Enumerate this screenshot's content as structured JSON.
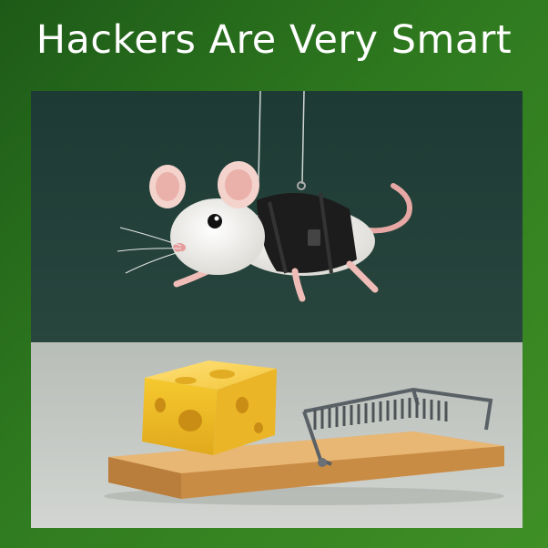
{
  "title": "Hackers Are Very Smart",
  "colors": {
    "frame_green": "#2f7a1f",
    "wall": "#213f38",
    "floor": "#c3c7c2",
    "cheese": "#f2c230",
    "trap_wood": "#d9a35a",
    "mouse_fur": "#f3f1ec",
    "harness": "#1c1c1c"
  },
  "icons": {
    "photo": "mouse-harness-cheese-trap-scene"
  }
}
